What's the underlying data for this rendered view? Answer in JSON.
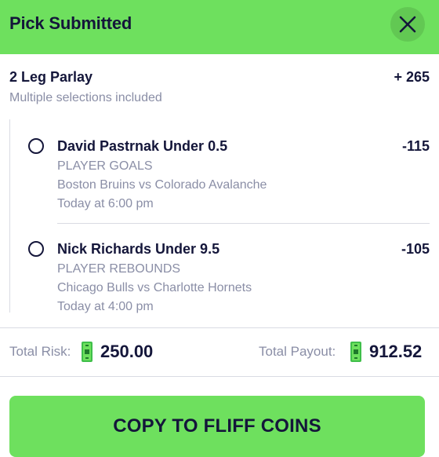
{
  "header": {
    "title": "Pick Submitted",
    "close_icon": "close-icon"
  },
  "parlay": {
    "title": "2 Leg Parlay",
    "odds": "+ 265",
    "subtitle": "Multiple selections included"
  },
  "legs": [
    {
      "name": "David Pastrnak Under 0.5",
      "odds": "-115",
      "market": "PLAYER GOALS",
      "matchup": "Boston Bruins vs Colorado Avalanche",
      "time": "Today at 6:00 pm"
    },
    {
      "name": "Nick Richards Under 9.5",
      "odds": "-105",
      "market": "PLAYER REBOUNDS",
      "matchup": "Chicago Bulls vs Charlotte Hornets",
      "time": "Today at 4:00 pm"
    }
  ],
  "totals": {
    "risk_label": "Total Risk:",
    "risk_value": "250.00",
    "payout_label": "Total Payout:",
    "payout_value": "912.52",
    "coin_icon": "fliff-cash-icon"
  },
  "cta": {
    "label": "COPY TO FLIFF COINS"
  },
  "colors": {
    "brand_green": "#6ee05e",
    "text_dark": "#14163a",
    "text_muted": "#8a8ea6"
  }
}
